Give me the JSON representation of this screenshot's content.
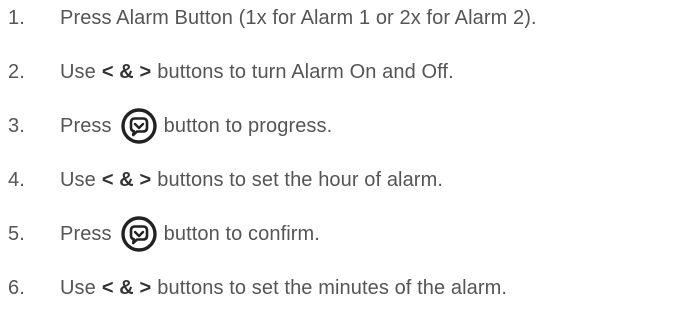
{
  "steps": [
    {
      "number": "1.",
      "text": "Press Alarm Button (1x for Alarm 1 or 2x for Alarm 2)."
    },
    {
      "number": "2.",
      "pre": "Use",
      "keys": "< & >",
      "post": "buttons to turn Alarm On and Off."
    },
    {
      "number": "3.",
      "pre": "Press",
      "icon": "confirm-button-icon",
      "post": "button to progress."
    },
    {
      "number": "4.",
      "pre": "Use",
      "keys": "< & >",
      "post": "buttons to set the hour of alarm."
    },
    {
      "number": "5.",
      "pre": "Press",
      "icon": "confirm-button-icon",
      "post": "button to confirm."
    },
    {
      "number": "6.",
      "pre": "Use",
      "keys": "< & >",
      "post": "buttons to set the minutes of the alarm."
    }
  ],
  "colors": {
    "text": "#555555",
    "bold_text": "#333333",
    "icon": "#222222"
  }
}
